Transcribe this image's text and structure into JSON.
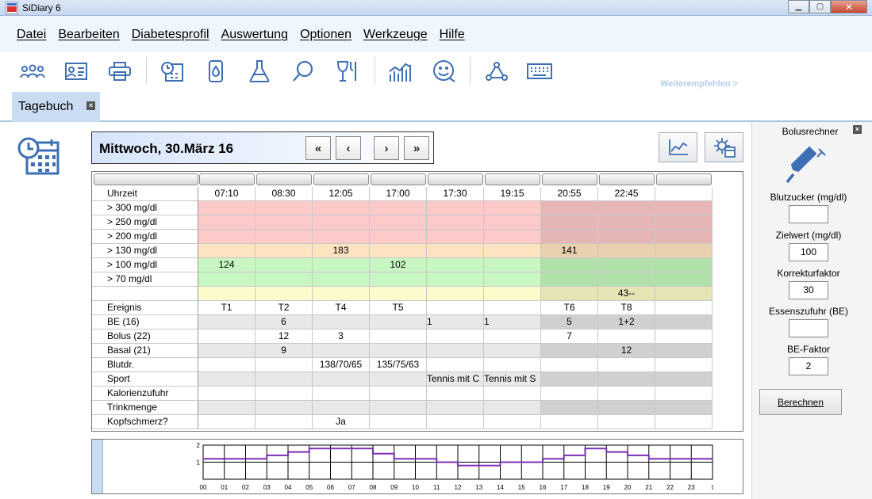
{
  "window": {
    "title": "SiDiary 6",
    "buttons": {
      "minimize": "▁",
      "maximize": "▢",
      "close": "✕"
    }
  },
  "menu": [
    "Datei",
    "Bearbeiten",
    "Diabetesprofil",
    "Auswertung",
    "Optionen",
    "Werkzeuge",
    "Hilfe"
  ],
  "toolbar": {
    "icons": [
      "people-icon",
      "contact-card-icon",
      "printer-icon",
      "clock-calendar-icon",
      "blood-drop-meter-icon",
      "flask-icon",
      "search-icon",
      "cup-fork-icon",
      "chart-bars-icon",
      "smiley-icon",
      "network-icon",
      "keyboard-icon"
    ],
    "recommend": "Weiterempfehlen >"
  },
  "tab": {
    "label": "Tagebuch",
    "close": "×"
  },
  "datenav": {
    "date": "Mittwoch, 30.März 16",
    "buttons": [
      "«",
      "‹",
      "›",
      "»"
    ]
  },
  "grid": {
    "times": [
      "07:10",
      "08:30",
      "12:05",
      "17:00",
      "17:30",
      "19:15",
      "20:55",
      "22:45",
      ""
    ],
    "header_label": "Uhrzeit",
    "rows": [
      {
        "label": "> 300 mg/dl",
        "values": [
          "",
          "",
          "",
          "",
          "",
          "",
          "",
          "",
          ""
        ],
        "band": "red"
      },
      {
        "label": "> 250 mg/dl",
        "values": [
          "",
          "",
          "",
          "",
          "",
          "",
          "",
          "",
          ""
        ],
        "band": "red"
      },
      {
        "label": "> 200 mg/dl",
        "values": [
          "",
          "",
          "",
          "",
          "",
          "",
          "",
          "",
          ""
        ],
        "band": "red"
      },
      {
        "label": "> 130 mg/dl",
        "values": [
          "",
          "",
          "183",
          "",
          "",
          "",
          "141",
          "",
          ""
        ],
        "band": "orange"
      },
      {
        "label": "> 100 mg/dl",
        "values": [
          "124",
          "",
          "",
          "102",
          "",
          "",
          "",
          "",
          ""
        ],
        "band": "green"
      },
      {
        "label": ">   70 mg/dl",
        "values": [
          "",
          "",
          "",
          "",
          "",
          "",
          "",
          "",
          ""
        ],
        "band": "green"
      },
      {
        "label": "",
        "values": [
          "",
          "",
          "",
          "",
          "",
          "",
          "",
          "43--",
          ""
        ],
        "band": "yellow"
      },
      {
        "label": "Ereignis",
        "values": [
          "T1",
          "T2",
          "T4",
          "T5",
          "",
          "",
          "T6",
          "T8",
          ""
        ],
        "band": "white"
      },
      {
        "label": "BE (16)",
        "values": [
          "",
          "6",
          "",
          "",
          "1",
          "1",
          "5",
          "1+2",
          ""
        ],
        "band": "gray"
      },
      {
        "label": "Bolus (22)",
        "values": [
          "",
          "12",
          "3",
          "",
          "",
          "",
          "7",
          "",
          ""
        ],
        "band": "white"
      },
      {
        "label": "Basal (21)",
        "values": [
          "",
          "9",
          "",
          "",
          "",
          "",
          "",
          "12",
          ""
        ],
        "band": "gray"
      },
      {
        "label": "Blutdr.",
        "values": [
          "",
          "",
          "138/70/65",
          "135/75/63",
          "",
          "",
          "",
          "",
          ""
        ],
        "band": "white"
      },
      {
        "label": "Sport",
        "values": [
          "",
          "",
          "",
          "",
          "Tennis mit C",
          "Tennis mit S",
          "",
          "",
          ""
        ],
        "band": "gray"
      },
      {
        "label": "Kalorienzufuhr",
        "values": [
          "",
          "",
          "",
          "",
          "",
          "",
          "",
          "",
          ""
        ],
        "band": "white"
      },
      {
        "label": "Trinkmenge",
        "values": [
          "",
          "",
          "",
          "",
          "",
          "",
          "",
          "",
          ""
        ],
        "band": "gray"
      },
      {
        "label": "Kopfschmerz?",
        "values": [
          "",
          "",
          "Ja",
          "",
          "",
          "",
          "",
          "",
          ""
        ],
        "band": "white"
      }
    ]
  },
  "minichart": {
    "y_ticks": [
      "2",
      "1"
    ],
    "x_ticks": [
      "00",
      "01",
      "02",
      "03",
      "04",
      "05",
      "06",
      "07",
      "08",
      "09",
      "10",
      "11",
      "12",
      "13",
      "14",
      "15",
      "16",
      "17",
      "18",
      "19",
      "20",
      "21",
      "22",
      "23",
      "t"
    ],
    "series": [
      1.2,
      1.2,
      1.2,
      1.4,
      1.6,
      1.8,
      1.8,
      1.8,
      1.5,
      1.2,
      1.2,
      1.0,
      0.8,
      0.8,
      1.0,
      1.0,
      1.2,
      1.4,
      1.8,
      1.6,
      1.4,
      1.2,
      1.2,
      1.2
    ],
    "color": "#7b2fb5"
  },
  "bolus": {
    "title": "Bolusrechner",
    "close": "×",
    "fields": [
      {
        "label": "Blutzucker (mg/dl)",
        "value": ""
      },
      {
        "label": "Zielwert (mg/dl)",
        "value": "100"
      },
      {
        "label": "Korrekturfaktor",
        "value": "30"
      },
      {
        "label": "Essenszufuhr (BE)",
        "value": ""
      },
      {
        "label": "BE-Faktor",
        "value": "2"
      }
    ],
    "button": "Berechnen"
  },
  "colors": {
    "red": "#fdcaca",
    "red_dark": "#e6b6b6",
    "orange": "#fde3c0",
    "orange_dark": "#e9d0ae",
    "green": "#c9f7c4",
    "green_dark": "#b2e0ab",
    "yellow": "#fcfbcc",
    "yellow_dark": "#e6e4b5",
    "gray": "#e8e8e8",
    "gray_dark": "#d0d0d0",
    "white": "#ffffff",
    "white_dark": "#ffffff",
    "accent": "#3d6fb4"
  }
}
